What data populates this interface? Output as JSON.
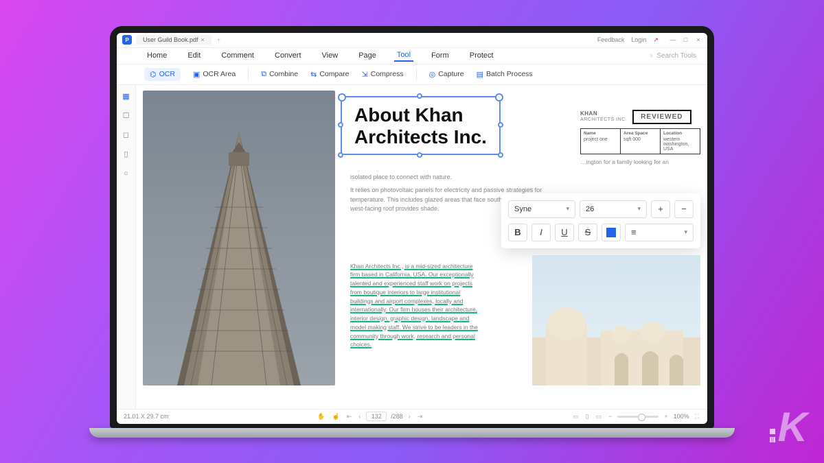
{
  "titlebar": {
    "filename": "User Guild Book.pdf",
    "feedback": "Feedback",
    "login": "Login"
  },
  "menubar": {
    "items": [
      "Home",
      "Edit",
      "Comment",
      "Convert",
      "View",
      "Page",
      "Tool",
      "Form",
      "Protect"
    ],
    "active_index": 6,
    "search_placeholder": "Search Tools"
  },
  "ribbon": {
    "items": [
      "OCR",
      "OCR Area",
      "Combine",
      "Compare",
      "Compress",
      "Capture",
      "Batch Process"
    ],
    "active_index": 0
  },
  "sidebar": {
    "icons": [
      "thumbnails",
      "bookmark",
      "comment",
      "attachment",
      "search"
    ]
  },
  "document": {
    "heading_line1": "About Khan",
    "heading_line2": "Architects Inc.",
    "stamp": {
      "name": "KHAN",
      "sub": "ARCHITECTS INC.",
      "badge": "REVIEWED",
      "cols": [
        {
          "h": "Name",
          "v": "project one"
        },
        {
          "h": "Area Space",
          "v": "sqft 000"
        },
        {
          "h": "Location",
          "v": "western washington, USA"
        }
      ]
    },
    "intro_right": "…ington for a family looking for an",
    "intro1": "isolated place to connect with nature.",
    "intro2": "It relies on photovoltaic panels for electricity and passive strategies for temperature. This includes glazed areas that face south while the extended west-facing roof provides shade.",
    "body": "Khan Architects Inc., is a mid-sized architecture firm based in California, USA. Our exceptionally talented and experienced staff work on projects from boutique interiors to large institutional buildings and airport complexes, locally and internationally. Our firm houses their architecture, interior design, graphic design, landscape and model making staff. We strive to be leaders in the community through work, research and personal choices."
  },
  "format_toolbar": {
    "font": "Syne",
    "size": "26",
    "color": "#2563eb"
  },
  "statusbar": {
    "dims": "21.01 X 29.7 cm",
    "page_current": "132",
    "page_total": "/288",
    "zoom": "100%"
  }
}
